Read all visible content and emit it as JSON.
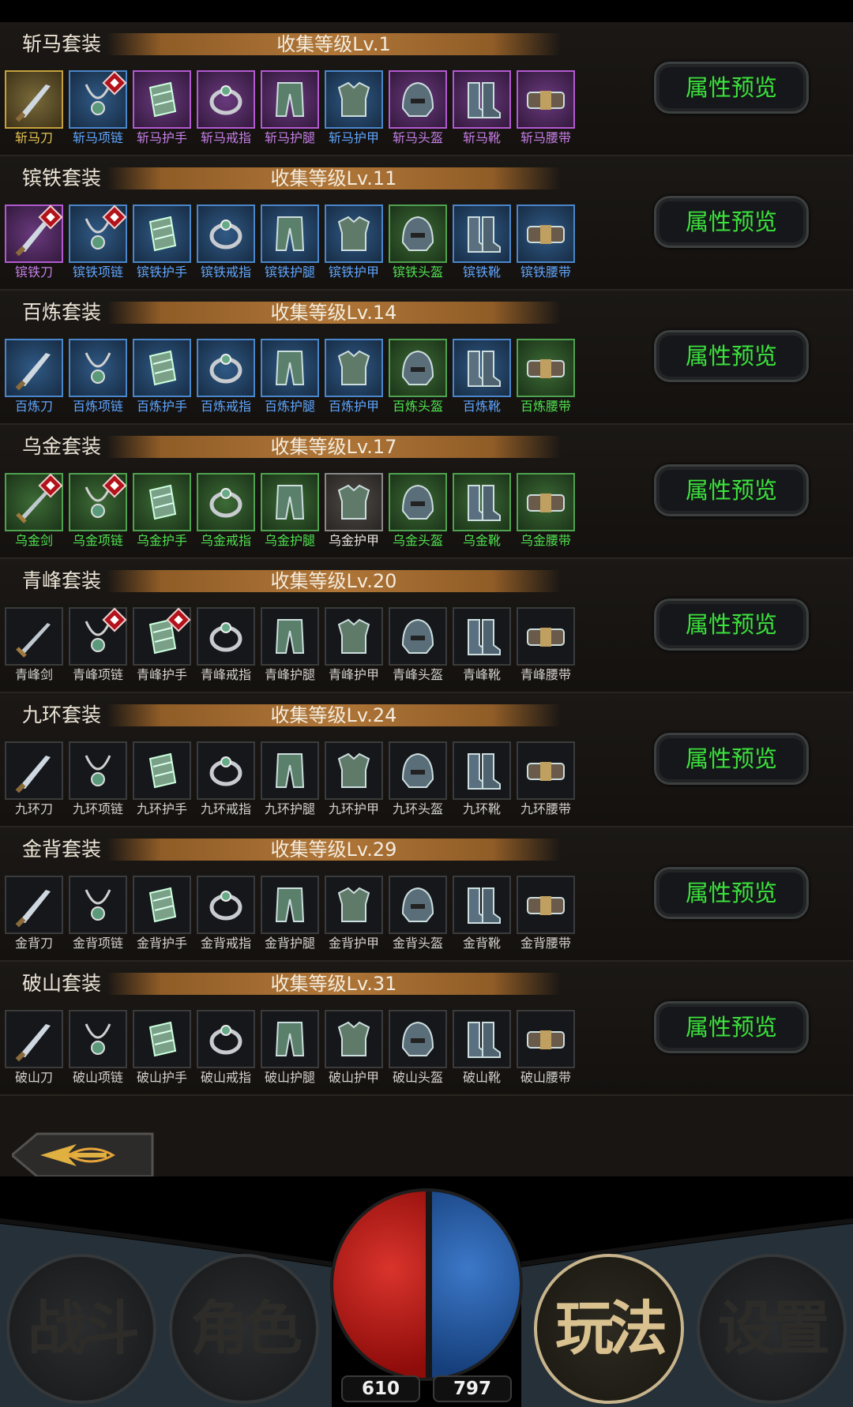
{
  "colors": {
    "gold": "#e6c552",
    "purple": "#c77fe6",
    "blue": "#5fa6ff",
    "green": "#4fe24f",
    "white": "#e8e6e2",
    "grey": "#d4d2ce",
    "preview_button_text": "#3ce23c"
  },
  "sets": [
    {
      "name": "斩马套装",
      "level": "收集等级Lv.1",
      "preview_label": "属性预览",
      "items": [
        {
          "label": "斩马刀",
          "quality": "gold",
          "icon": "blade-icon",
          "badge": false
        },
        {
          "label": "斩马项链",
          "quality": "blue",
          "icon": "necklace-icon",
          "badge": true
        },
        {
          "label": "斩马护手",
          "quality": "purple",
          "icon": "bracer-icon",
          "badge": false
        },
        {
          "label": "斩马戒指",
          "quality": "purple",
          "icon": "ring-icon",
          "badge": false
        },
        {
          "label": "斩马护腿",
          "quality": "purple",
          "icon": "leggings-icon",
          "badge": false
        },
        {
          "label": "斩马护甲",
          "quality": "blue",
          "icon": "armor-icon",
          "badge": false
        },
        {
          "label": "斩马头盔",
          "quality": "purple",
          "icon": "helmet-icon",
          "badge": false
        },
        {
          "label": "斩马靴",
          "quality": "purple",
          "icon": "boots-icon",
          "badge": false
        },
        {
          "label": "斩马腰带",
          "quality": "purple",
          "icon": "belt-icon",
          "badge": false
        }
      ]
    },
    {
      "name": "镔铁套装",
      "level": "收集等级Lv.11",
      "preview_label": "属性预览",
      "items": [
        {
          "label": "镔铁刀",
          "quality": "purple",
          "icon": "blade-icon",
          "badge": true
        },
        {
          "label": "镔铁项链",
          "quality": "blue",
          "icon": "necklace-icon",
          "badge": true
        },
        {
          "label": "镔铁护手",
          "quality": "blue",
          "icon": "bracer-icon",
          "badge": false
        },
        {
          "label": "镔铁戒指",
          "quality": "blue",
          "icon": "ring-icon",
          "badge": false
        },
        {
          "label": "镔铁护腿",
          "quality": "blue",
          "icon": "leggings-icon",
          "badge": false
        },
        {
          "label": "镔铁护甲",
          "quality": "blue",
          "icon": "armor-icon",
          "badge": false
        },
        {
          "label": "镔铁头盔",
          "quality": "green",
          "icon": "helmet-icon",
          "badge": false
        },
        {
          "label": "镔铁靴",
          "quality": "blue",
          "icon": "boots-icon",
          "badge": false
        },
        {
          "label": "镔铁腰带",
          "quality": "blue",
          "icon": "belt-icon",
          "badge": false
        }
      ]
    },
    {
      "name": "百炼套装",
      "level": "收集等级Lv.14",
      "preview_label": "属性预览",
      "items": [
        {
          "label": "百炼刀",
          "quality": "blue",
          "icon": "blade-icon",
          "badge": false
        },
        {
          "label": "百炼项链",
          "quality": "blue",
          "icon": "necklace-icon",
          "badge": false
        },
        {
          "label": "百炼护手",
          "quality": "blue",
          "icon": "bracer-icon",
          "badge": false
        },
        {
          "label": "百炼戒指",
          "quality": "blue",
          "icon": "ring-icon",
          "badge": false
        },
        {
          "label": "百炼护腿",
          "quality": "blue",
          "icon": "leggings-icon",
          "badge": false
        },
        {
          "label": "百炼护甲",
          "quality": "blue",
          "icon": "armor-icon",
          "badge": false
        },
        {
          "label": "百炼头盔",
          "quality": "green",
          "icon": "helmet-icon",
          "badge": false
        },
        {
          "label": "百炼靴",
          "quality": "blue",
          "icon": "boots-icon",
          "badge": false
        },
        {
          "label": "百炼腰带",
          "quality": "green",
          "icon": "belt-icon",
          "badge": false
        }
      ]
    },
    {
      "name": "乌金套装",
      "level": "收集等级Lv.17",
      "preview_label": "属性预览",
      "items": [
        {
          "label": "乌金剑",
          "quality": "green",
          "icon": "sword-icon",
          "badge": true
        },
        {
          "label": "乌金项链",
          "quality": "green",
          "icon": "necklace-icon",
          "badge": true
        },
        {
          "label": "乌金护手",
          "quality": "green",
          "icon": "bracer-icon",
          "badge": false
        },
        {
          "label": "乌金戒指",
          "quality": "green",
          "icon": "ring-icon",
          "badge": false
        },
        {
          "label": "乌金护腿",
          "quality": "green",
          "icon": "leggings-icon",
          "badge": false
        },
        {
          "label": "乌金护甲",
          "quality": "white",
          "icon": "armor-icon",
          "badge": false
        },
        {
          "label": "乌金头盔",
          "quality": "green",
          "icon": "helmet-icon",
          "badge": false
        },
        {
          "label": "乌金靴",
          "quality": "green",
          "icon": "boots-icon",
          "badge": false
        },
        {
          "label": "乌金腰带",
          "quality": "green",
          "icon": "belt-icon",
          "badge": false
        }
      ]
    },
    {
      "name": "青峰套装",
      "level": "收集等级Lv.20",
      "preview_label": "属性预览",
      "items": [
        {
          "label": "青峰剑",
          "quality": "grey",
          "icon": "sword-icon",
          "badge": false
        },
        {
          "label": "青峰项链",
          "quality": "grey",
          "icon": "necklace-icon",
          "badge": true
        },
        {
          "label": "青峰护手",
          "quality": "grey",
          "icon": "bracer-icon",
          "badge": true
        },
        {
          "label": "青峰戒指",
          "quality": "grey",
          "icon": "ring-icon",
          "badge": false
        },
        {
          "label": "青峰护腿",
          "quality": "grey",
          "icon": "leggings-icon",
          "badge": false
        },
        {
          "label": "青峰护甲",
          "quality": "grey",
          "icon": "armor-icon",
          "badge": false
        },
        {
          "label": "青峰头盔",
          "quality": "grey",
          "icon": "helmet-icon",
          "badge": false
        },
        {
          "label": "青峰靴",
          "quality": "grey",
          "icon": "boots-icon",
          "badge": false
        },
        {
          "label": "青峰腰带",
          "quality": "grey",
          "icon": "belt-icon",
          "badge": false
        }
      ]
    },
    {
      "name": "九环套装",
      "level": "收集等级Lv.24",
      "preview_label": "属性预览",
      "items": [
        {
          "label": "九环刀",
          "quality": "grey",
          "icon": "blade-icon",
          "badge": false
        },
        {
          "label": "九环项链",
          "quality": "grey",
          "icon": "necklace-icon",
          "badge": false
        },
        {
          "label": "九环护手",
          "quality": "grey",
          "icon": "bracer-icon",
          "badge": false
        },
        {
          "label": "九环戒指",
          "quality": "grey",
          "icon": "ring-icon",
          "badge": false
        },
        {
          "label": "九环护腿",
          "quality": "grey",
          "icon": "leggings-icon",
          "badge": false
        },
        {
          "label": "九环护甲",
          "quality": "grey",
          "icon": "armor-icon",
          "badge": false
        },
        {
          "label": "九环头盔",
          "quality": "grey",
          "icon": "helmet-icon",
          "badge": false
        },
        {
          "label": "九环靴",
          "quality": "grey",
          "icon": "boots-icon",
          "badge": false
        },
        {
          "label": "九环腰带",
          "quality": "grey",
          "icon": "belt-icon",
          "badge": false
        }
      ]
    },
    {
      "name": "金背套装",
      "level": "收集等级Lv.29",
      "preview_label": "属性预览",
      "items": [
        {
          "label": "金背刀",
          "quality": "grey",
          "icon": "blade-icon",
          "badge": false
        },
        {
          "label": "金背项链",
          "quality": "grey",
          "icon": "necklace-icon",
          "badge": false
        },
        {
          "label": "金背护手",
          "quality": "grey",
          "icon": "bracer-icon",
          "badge": false
        },
        {
          "label": "金背戒指",
          "quality": "grey",
          "icon": "ring-icon",
          "badge": false
        },
        {
          "label": "金背护腿",
          "quality": "grey",
          "icon": "leggings-icon",
          "badge": false
        },
        {
          "label": "金背护甲",
          "quality": "grey",
          "icon": "armor-icon",
          "badge": false
        },
        {
          "label": "金背头盔",
          "quality": "grey",
          "icon": "helmet-icon",
          "badge": false
        },
        {
          "label": "金背靴",
          "quality": "grey",
          "icon": "boots-icon",
          "badge": false
        },
        {
          "label": "金背腰带",
          "quality": "grey",
          "icon": "belt-icon",
          "badge": false
        }
      ]
    },
    {
      "name": "破山套装",
      "level": "收集等级Lv.31",
      "preview_label": "属性预览",
      "items": [
        {
          "label": "破山刀",
          "quality": "grey",
          "icon": "blade-icon",
          "badge": false
        },
        {
          "label": "破山项链",
          "quality": "grey",
          "icon": "necklace-icon",
          "badge": false
        },
        {
          "label": "破山护手",
          "quality": "grey",
          "icon": "bracer-icon",
          "badge": false
        },
        {
          "label": "破山戒指",
          "quality": "grey",
          "icon": "ring-icon",
          "badge": false
        },
        {
          "label": "破山护腿",
          "quality": "grey",
          "icon": "leggings-icon",
          "badge": false
        },
        {
          "label": "破山护甲",
          "quality": "grey",
          "icon": "armor-icon",
          "badge": false
        },
        {
          "label": "破山头盔",
          "quality": "grey",
          "icon": "helmet-icon",
          "badge": false
        },
        {
          "label": "破山靴",
          "quality": "grey",
          "icon": "boots-icon",
          "badge": false
        },
        {
          "label": "破山腰带",
          "quality": "grey",
          "icon": "belt-icon",
          "badge": false
        }
      ]
    }
  ],
  "back_button": {
    "icon": "back-arrow-icon"
  },
  "nav": {
    "battle": "战斗",
    "character": "角色",
    "gameplay": "玩法",
    "settings": "设置",
    "active": "gameplay"
  },
  "stats": {
    "hp": "610",
    "mp": "797"
  }
}
